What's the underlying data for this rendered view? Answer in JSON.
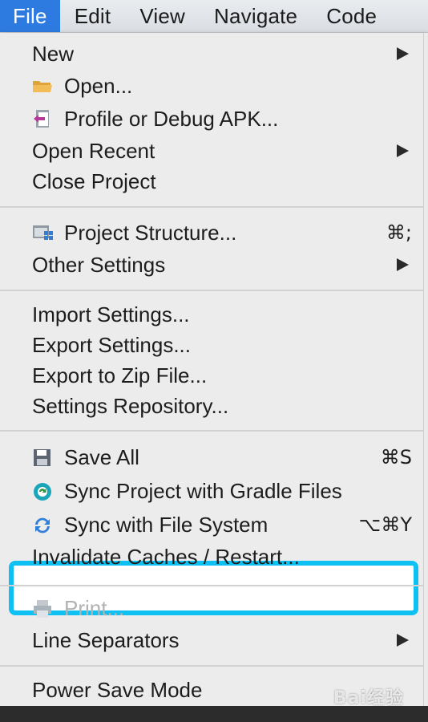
{
  "menubar": {
    "items": [
      {
        "label": "File",
        "active": true
      },
      {
        "label": "Edit"
      },
      {
        "label": "View"
      },
      {
        "label": "Navigate"
      },
      {
        "label": "Code"
      }
    ]
  },
  "file_menu": {
    "new": {
      "label": "New"
    },
    "open": {
      "label": "Open...",
      "icon": "folder-icon"
    },
    "profile_debug": {
      "label": "Profile or Debug APK...",
      "icon": "apk-icon"
    },
    "open_recent": {
      "label": "Open Recent"
    },
    "close_project": {
      "label": "Close Project"
    },
    "project_structure": {
      "label": "Project Structure...",
      "shortcut": "⌘;",
      "icon": "project-structure-icon"
    },
    "other_settings": {
      "label": "Other Settings"
    },
    "import_settings": {
      "label": "Import Settings..."
    },
    "export_settings": {
      "label": "Export Settings..."
    },
    "export_zip": {
      "label": "Export to Zip File..."
    },
    "settings_repository": {
      "label": "Settings Repository..."
    },
    "save_all": {
      "label": "Save All",
      "shortcut": "⌘S",
      "icon": "save-icon"
    },
    "sync_gradle": {
      "label": "Sync Project with Gradle Files",
      "icon": "gradle-sync-icon"
    },
    "sync_fs": {
      "label": "Sync with File System",
      "shortcut": "⌥⌘Y",
      "icon": "sync-icon"
    },
    "invalidate_caches": {
      "label": "Invalidate Caches / Restart..."
    },
    "print": {
      "label": "Print...",
      "icon": "print-icon",
      "disabled": true
    },
    "line_separators": {
      "label": "Line Separators"
    },
    "power_save": {
      "label": "Power Save Mode"
    }
  },
  "highlight_color": "#0ec1f2",
  "watermark": "Bai经验"
}
